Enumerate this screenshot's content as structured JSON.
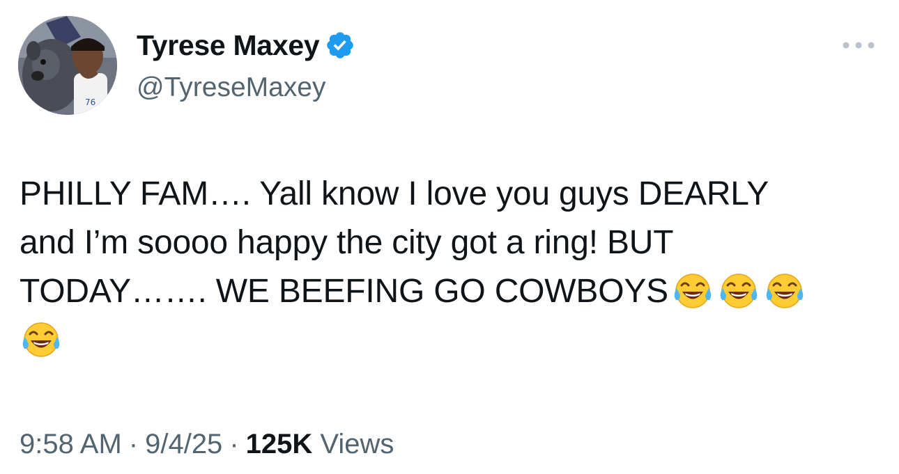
{
  "author": {
    "display_name": "Tyrese Maxey",
    "handle": "@TyreseMaxey",
    "verified": true,
    "avatar_icon": "profile-photo-person-with-dog"
  },
  "tweet": {
    "line1": "PHILLY FAM…. Yall know I love you guys DEARLY",
    "line2": "and I’m soooo happy the city got a ring! BUT",
    "line3": "TODAY……. WE BEEFING GO COWBOYS",
    "emoji": "face-with-tears-of-joy",
    "emoji_count": 4
  },
  "meta": {
    "time": "9:58 AM",
    "date": "9/4/25",
    "views_count": "125K",
    "views_label": "Views",
    "separator": "·"
  },
  "icons": {
    "more": "more-dots-icon",
    "verified": "verified-badge-icon"
  },
  "colors": {
    "verified_blue": "#1d9bf0",
    "secondary_text": "#536471",
    "primary_text": "#0f1419"
  }
}
